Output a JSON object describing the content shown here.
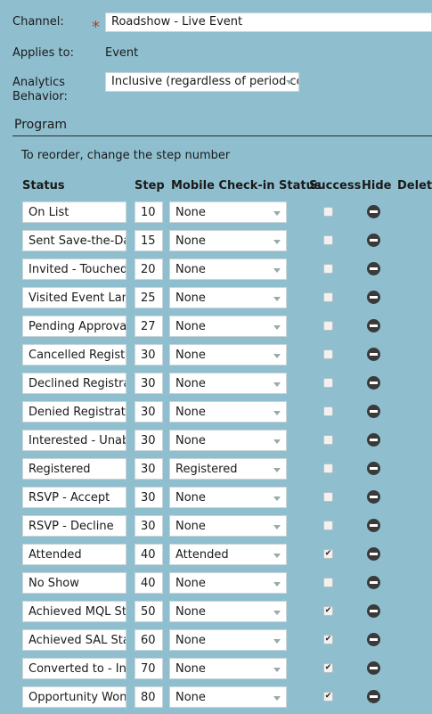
{
  "form": {
    "channel_label": "Channel:",
    "channel_value": "Roadshow - Live Event",
    "applies_label": "Applies to:",
    "applies_value": "Event",
    "analytics_label_1": "Analytics",
    "analytics_label_2": "Behavior:",
    "analytics_value": "Inclusive (regardless of period co"
  },
  "program": {
    "title": "Program",
    "hint": "To reorder, change the step number",
    "columns": {
      "status": "Status",
      "step": "Step",
      "mobile": "Mobile Check-in Status",
      "success": "Success",
      "hide": "Hide",
      "delete": "Delete"
    },
    "rows": [
      {
        "status": "On List",
        "step": "10",
        "mobile": "None",
        "success": false
      },
      {
        "status": "Sent Save-the-Date",
        "step": "15",
        "mobile": "None",
        "success": false
      },
      {
        "status": "Invited - Touched",
        "step": "20",
        "mobile": "None",
        "success": false
      },
      {
        "status": "Visited Event Landing",
        "step": "25",
        "mobile": "None",
        "success": false
      },
      {
        "status": "Pending Approval",
        "step": "27",
        "mobile": "None",
        "success": false
      },
      {
        "status": "Cancelled Registration",
        "step": "30",
        "mobile": "None",
        "success": false
      },
      {
        "status": "Declined Registration",
        "step": "30",
        "mobile": "None",
        "success": false
      },
      {
        "status": "Denied Registration",
        "step": "30",
        "mobile": "None",
        "success": false
      },
      {
        "status": "Interested - Unable",
        "step": "30",
        "mobile": "None",
        "success": false
      },
      {
        "status": "Registered",
        "step": "30",
        "mobile": "Registered",
        "success": false
      },
      {
        "status": "RSVP - Accept",
        "step": "30",
        "mobile": "None",
        "success": false
      },
      {
        "status": "RSVP - Decline",
        "step": "30",
        "mobile": "None",
        "success": false
      },
      {
        "status": "Attended",
        "step": "40",
        "mobile": "Attended",
        "success": true
      },
      {
        "status": "No Show",
        "step": "40",
        "mobile": "None",
        "success": false
      },
      {
        "status": "Achieved MQL Status",
        "step": "50",
        "mobile": "None",
        "success": true
      },
      {
        "status": "Achieved SAL Status",
        "step": "60",
        "mobile": "None",
        "success": true
      },
      {
        "status": "Converted to - Influenced",
        "step": "70",
        "mobile": "None",
        "success": true
      },
      {
        "status": "Opportunity Won",
        "step": "80",
        "mobile": "None",
        "success": true
      }
    ],
    "check_glyph": "✔"
  }
}
